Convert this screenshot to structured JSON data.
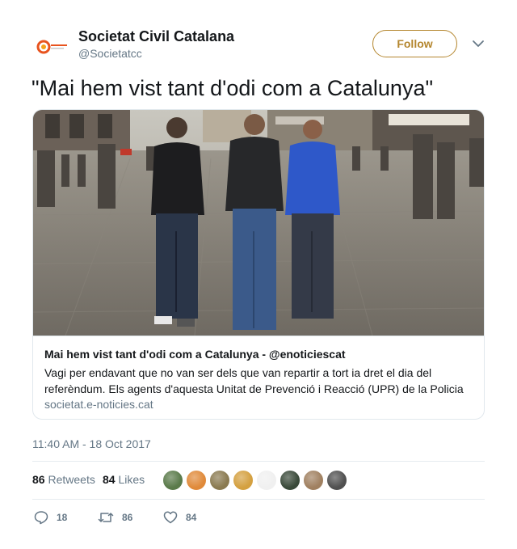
{
  "account": {
    "name": "Societat Civil Catalana",
    "handle": "@Societatcc",
    "avatar_icon": "societat-civil-catalana-logo",
    "follow_label": "Follow",
    "accent_color": "#b4862e"
  },
  "tweet": {
    "text": "\"Mai hem vist tant d'odi com a Catalunya\""
  },
  "card": {
    "image_icon": "street-photo",
    "title": "Mai hem vist tant d'odi com a Catalunya - @enoticiescat",
    "description": "Vagi per endavant que no van ser dels que van repartir a tort ia dret el dia del referèndum. Els agents d'aquesta Unitat de Prevenció i Reacció (UPR) de la Policia",
    "domain": "societat.e-noticies.cat"
  },
  "timestamp": "11:40 AM - 18 Oct 2017",
  "stats": {
    "retweets_count": "86",
    "retweets_label": "Retweets",
    "likes_count": "84",
    "likes_label": "Likes",
    "liker_avatars": [
      "#5a7a4a",
      "#e08a3a",
      "#8a7a50",
      "#d4a040",
      "#f0f0f0",
      "#3a4a3a",
      "#a08060",
      "#505050"
    ]
  },
  "actions": {
    "reply_count": "18",
    "retweet_count": "86",
    "like_count": "84"
  }
}
